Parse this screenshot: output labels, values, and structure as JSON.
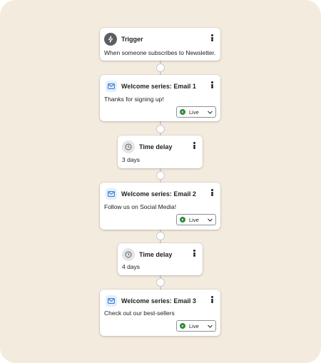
{
  "workflow": {
    "trigger": {
      "title": "Trigger",
      "description": "When someone subscribes to Newsletter.",
      "icon": "lightning-icon"
    },
    "steps": [
      {
        "type": "email",
        "title": "Welcome series: Email 1",
        "description": "Thanks for signing up!",
        "status": "Live",
        "icon": "mail-icon"
      },
      {
        "type": "delay",
        "title": "Time delay",
        "description": "3 days",
        "icon": "clock-icon"
      },
      {
        "type": "email",
        "title": "Welcome series: Email 2",
        "description": "Follow us on Social Media!",
        "status": "Live",
        "icon": "mail-icon"
      },
      {
        "type": "delay",
        "title": "Time delay",
        "description": "4 days",
        "icon": "clock-icon"
      },
      {
        "type": "email",
        "title": "Welcome series: Email 3",
        "description": "Check out our best-sellers",
        "status": "Live",
        "icon": "mail-icon"
      }
    ]
  },
  "colors": {
    "background": "#f4ebdf",
    "card": "#ffffff",
    "live_status": "#2e8b3d",
    "mail_icon": "#2c6ecb",
    "connector": "#cfcfcf"
  }
}
